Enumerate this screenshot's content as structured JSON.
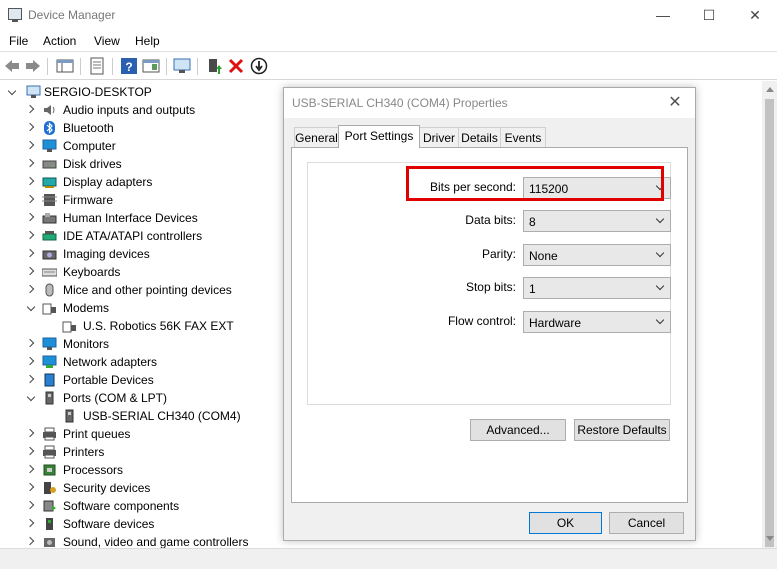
{
  "window": {
    "title": "Device Manager"
  },
  "menu": [
    "File",
    "Action",
    "View",
    "Help"
  ],
  "tree": {
    "root": "SERGIO-DESKTOP",
    "items": [
      {
        "label": "Audio inputs and outputs",
        "icon": "speaker-icon",
        "expanded": false
      },
      {
        "label": "Bluetooth",
        "icon": "bluetooth-icon",
        "expanded": false
      },
      {
        "label": "Computer",
        "icon": "monitor-icon",
        "expanded": false
      },
      {
        "label": "Disk drives",
        "icon": "disk-drive-icon",
        "expanded": false
      },
      {
        "label": "Display adapters",
        "icon": "display-adapter-icon",
        "expanded": false
      },
      {
        "label": "Firmware",
        "icon": "firmware-icon",
        "expanded": false
      },
      {
        "label": "Human Interface Devices",
        "icon": "hid-icon",
        "expanded": false
      },
      {
        "label": "IDE ATA/ATAPI controllers",
        "icon": "ide-controller-icon",
        "expanded": false
      },
      {
        "label": "Imaging devices",
        "icon": "camera-icon",
        "expanded": false
      },
      {
        "label": "Keyboards",
        "icon": "keyboard-icon",
        "expanded": false
      },
      {
        "label": "Mice and other pointing devices",
        "icon": "mouse-icon",
        "expanded": false
      },
      {
        "label": "Modems",
        "icon": "modem-icon",
        "expanded": true
      },
      {
        "label": "U.S. Robotics 56K FAX EXT",
        "icon": "modem-icon",
        "child": true
      },
      {
        "label": "Monitors",
        "icon": "monitor-icon",
        "expanded": false
      },
      {
        "label": "Network adapters",
        "icon": "network-adapter-icon",
        "expanded": false
      },
      {
        "label": "Portable Devices",
        "icon": "portable-device-icon",
        "expanded": false
      },
      {
        "label": "Ports (COM & LPT)",
        "icon": "port-icon",
        "expanded": true
      },
      {
        "label": "USB-SERIAL CH340 (COM4)",
        "icon": "port-icon",
        "child": true
      },
      {
        "label": "Print queues",
        "icon": "printer-icon",
        "expanded": false
      },
      {
        "label": "Printers",
        "icon": "printer-icon",
        "expanded": false
      },
      {
        "label": "Processors",
        "icon": "processor-icon",
        "expanded": false
      },
      {
        "label": "Security devices",
        "icon": "security-device-icon",
        "expanded": false
      },
      {
        "label": "Software components",
        "icon": "software-component-icon",
        "expanded": false
      },
      {
        "label": "Software devices",
        "icon": "software-device-icon",
        "expanded": false
      },
      {
        "label": "Sound, video and game controllers",
        "icon": "sound-icon",
        "expanded": false
      }
    ]
  },
  "dialog": {
    "title": "USB-SERIAL CH340 (COM4) Properties",
    "tabs": [
      "General",
      "Port Settings",
      "Driver",
      "Details",
      "Events"
    ],
    "selected_tab": "Port Settings",
    "fields": [
      {
        "label": "Bits per second:",
        "value": "115200"
      },
      {
        "label": "Data bits:",
        "value": "8"
      },
      {
        "label": "Parity:",
        "value": "None"
      },
      {
        "label": "Stop bits:",
        "value": "1"
      },
      {
        "label": "Flow control:",
        "value": "Hardware"
      }
    ],
    "advanced_label": "Advanced...",
    "restore_label": "Restore Defaults",
    "ok_label": "OK",
    "cancel_label": "Cancel",
    "highlight_color": "#e00000"
  }
}
